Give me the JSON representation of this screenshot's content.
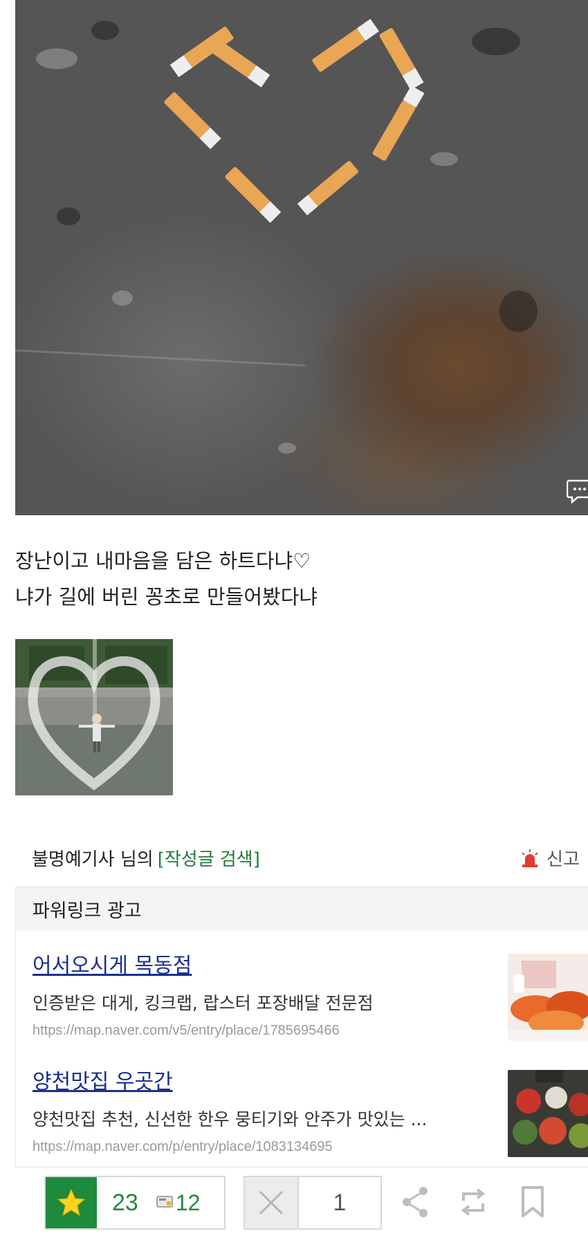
{
  "post": {
    "caption_line1": "장난이고 내마음을 담은 하트다냐♡",
    "caption_line2": "냐가 길에 버린 꽁초로 만들어봤다냐"
  },
  "author": {
    "name_suffix": "불명예기사 님의",
    "search_link": "[작성글 검색]",
    "report_label": "신고"
  },
  "powerlink": {
    "header": "파워링크 광고",
    "ads": [
      {
        "title": "어서오시게 목동점",
        "description": "인증받은 대게, 킹크랩, 랍스터 포장배달 전문점",
        "url": "https://map.naver.com/v5/entry/place/1785695466"
      },
      {
        "title": "양천맛집 우곳간",
        "description": "양천맛집 추천, 신선한 한우 뭉티기와 안주가 맛있는 ...",
        "url": "https://map.naver.com/p/entry/place/1083134695"
      }
    ]
  },
  "actions": {
    "like_count": "23",
    "scrap_count": "12",
    "hate_count": "1"
  },
  "colors": {
    "accent_green": "#1e8a3c",
    "ad_title_blue": "#1a2f8f",
    "report_red": "#e23b2e"
  }
}
